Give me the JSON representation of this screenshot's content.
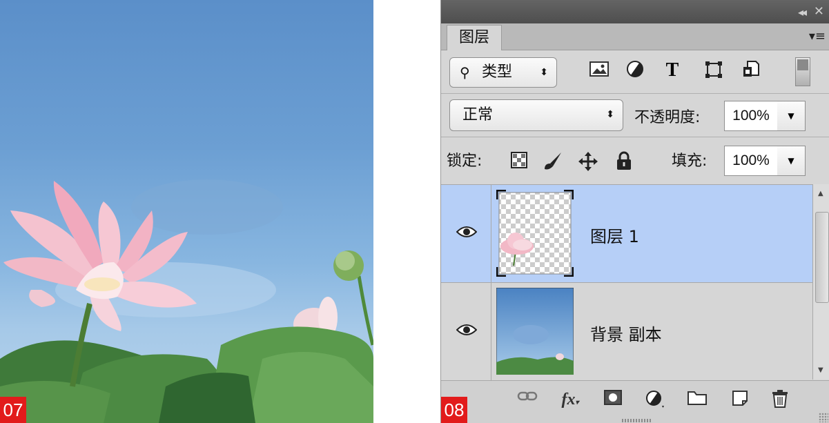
{
  "figures": [
    {
      "step_label": "07"
    },
    {
      "step_label": "08"
    }
  ],
  "panel": {
    "tab_title": "图层",
    "filter": {
      "type_label": "类型"
    },
    "blend_mode": "正常",
    "opacity_label": "不透明度:",
    "opacity_value": "100%",
    "lock_label": "锁定:",
    "fill_label": "填充:",
    "fill_value": "100%",
    "layers": [
      {
        "name": "图层 1",
        "selected": true,
        "visible": true
      },
      {
        "name": "背景 副本",
        "selected": false,
        "visible": true
      }
    ]
  },
  "icons": [
    "collapse-icon",
    "close-icon",
    "panel-menu-icon",
    "search-icon",
    "pixel-filter-icon",
    "adjustment-filter-icon",
    "type-filter-icon",
    "shape-filter-icon",
    "smart-object-filter-icon",
    "filter-toggle",
    "lock-transparent-icon",
    "lock-image-icon",
    "lock-position-icon",
    "lock-all-icon",
    "eye-icon",
    "link-icon",
    "fx-icon",
    "mask-icon",
    "adjustment-layer-icon",
    "folder-icon",
    "new-layer-icon",
    "trash-icon"
  ],
  "colors": {
    "badge": "#e21b1b",
    "selected_layer": "#b6cff7",
    "panel_bg": "#d6d6d6",
    "top_bar": "#545454"
  }
}
